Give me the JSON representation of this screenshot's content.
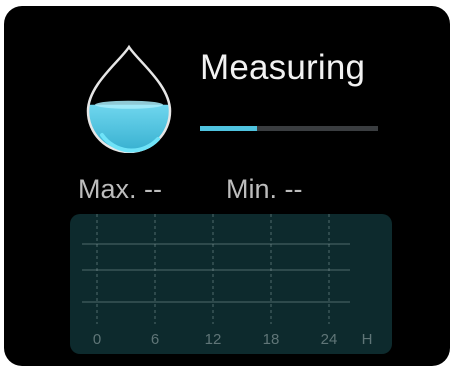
{
  "status": {
    "label": "Measuring",
    "progress": 0.32
  },
  "drop_icon": {
    "name": "water-drop-icon",
    "fill_level": 0.45
  },
  "stats": {
    "max_label": "Max.",
    "max_value": "--",
    "min_label": "Min.",
    "min_value": "--"
  },
  "chart_data": {
    "type": "line",
    "x_ticks": [
      "0",
      "6",
      "12",
      "18",
      "24"
    ],
    "x_unit": "H",
    "series": [],
    "grid": true
  },
  "colors": {
    "accent": "#4fc3df",
    "card_background": "#000000",
    "chart_background": "#0d2a2d",
    "track": "#3a3d40"
  }
}
